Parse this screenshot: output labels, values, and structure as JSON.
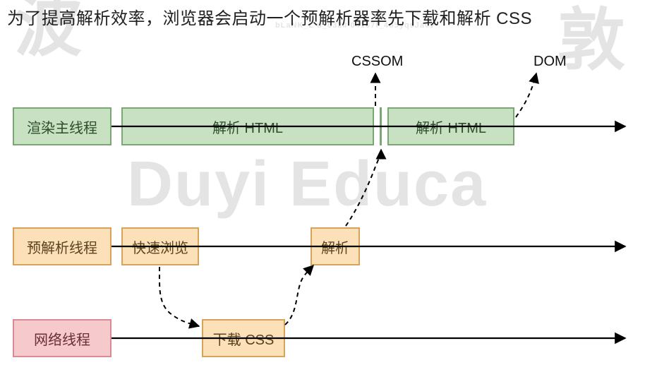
{
  "title": "为了提高解析效率，浏览器会启动一个预解析器率先下载和解析 CSS",
  "watermark_small": "bLaNK_L  u_6323   04167f_4o5yqsJa0v",
  "watermark_mid": "Duyi  Educa",
  "labels": {
    "cssom": "CSSOM",
    "dom": "DOM"
  },
  "rows": {
    "render": {
      "name": "渲染主线程",
      "parse_html_1": "解析 HTML",
      "parse_html_2": "解析 HTML"
    },
    "preparse": {
      "name": "预解析线程",
      "quick_scan": "快速浏览",
      "parse": "解析"
    },
    "network": {
      "name": "网络线程",
      "download_css": "下载 CSS"
    }
  }
}
